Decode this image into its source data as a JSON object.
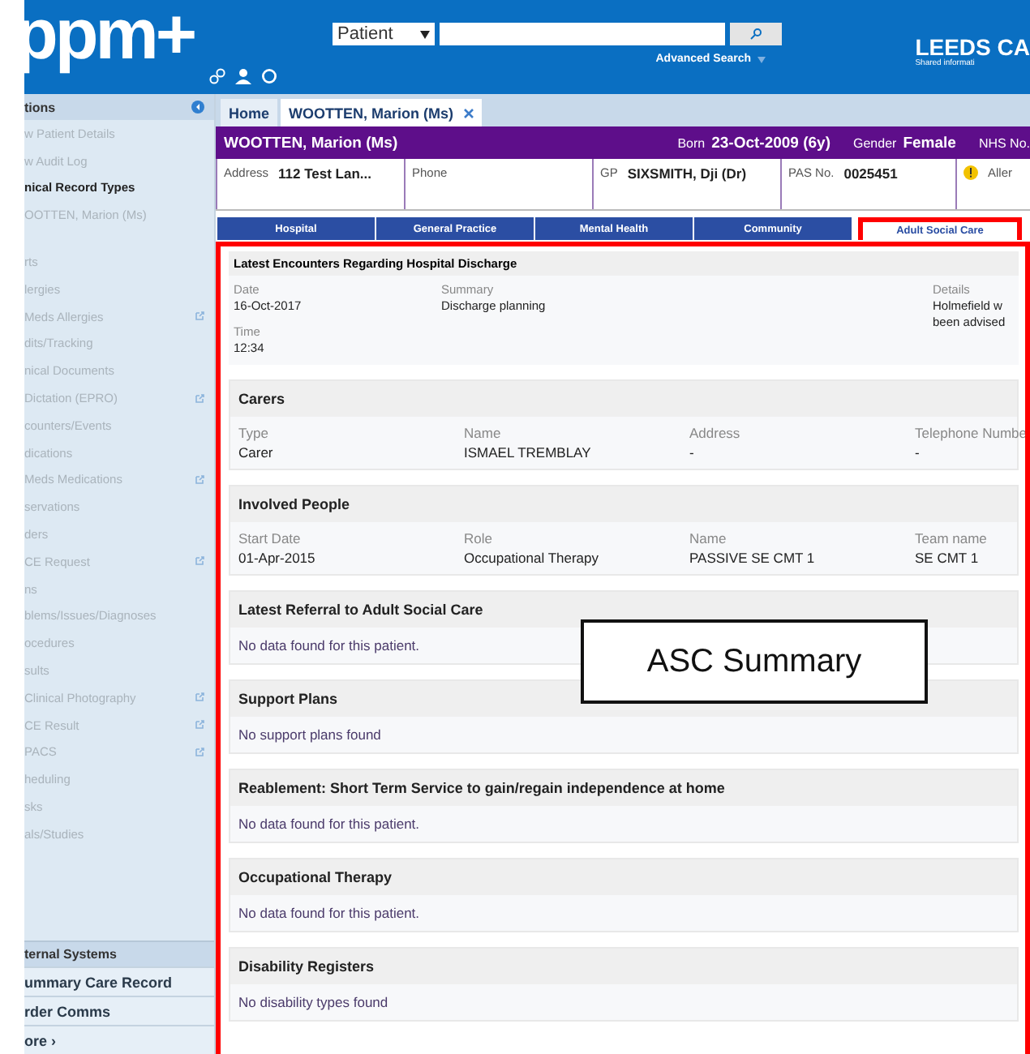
{
  "header": {
    "logo": "ppm+",
    "search_type": "Patient",
    "advanced_search": "Advanced Search",
    "brand": "LEEDS CA",
    "brand_sub": "Shared informati"
  },
  "sidebar": {
    "title": "tions",
    "items": [
      {
        "label": "w Patient Details",
        "kind": "link",
        "external": false
      },
      {
        "label": "w Audit Log",
        "kind": "link",
        "external": false
      },
      {
        "label": "nical Record Types",
        "kind": "heading",
        "external": false
      },
      {
        "label": "OOTTEN, Marion (Ms)",
        "kind": "link",
        "external": false
      },
      {
        "label": "rts",
        "kind": "gap",
        "external": false
      },
      {
        "label": "lergies",
        "kind": "link",
        "external": false
      },
      {
        "label": "Meds Allergies",
        "kind": "link",
        "external": true
      },
      {
        "label": "dits/Tracking",
        "kind": "link",
        "external": false
      },
      {
        "label": "nical Documents",
        "kind": "link",
        "external": false
      },
      {
        "label": "Dictation (EPRO)",
        "kind": "link",
        "external": true
      },
      {
        "label": "counters/Events",
        "kind": "link",
        "external": false
      },
      {
        "label": "dications",
        "kind": "link",
        "external": false
      },
      {
        "label": "Meds Medications",
        "kind": "link",
        "external": true
      },
      {
        "label": "servations",
        "kind": "link",
        "external": false
      },
      {
        "label": "ders",
        "kind": "link",
        "external": false
      },
      {
        "label": "CE Request",
        "kind": "link",
        "external": true
      },
      {
        "label": "ns",
        "kind": "link",
        "external": false
      },
      {
        "label": "blems/Issues/Diagnoses",
        "kind": "link",
        "external": false
      },
      {
        "label": "ocedures",
        "kind": "link",
        "external": false
      },
      {
        "label": "sults",
        "kind": "link",
        "external": false
      },
      {
        "label": "Clinical Photography",
        "kind": "link",
        "external": true
      },
      {
        "label": "CE Result",
        "kind": "link",
        "external": true
      },
      {
        "label": "PACS",
        "kind": "link",
        "external": true
      },
      {
        "label": "heduling",
        "kind": "link",
        "external": false
      },
      {
        "label": "sks",
        "kind": "link",
        "external": false
      },
      {
        "label": "als/Studies",
        "kind": "link",
        "external": false
      }
    ],
    "external_title": "ternal Systems",
    "external_items": [
      "ummary Care Record",
      "rder Comms",
      "ore ›"
    ]
  },
  "tabs": [
    {
      "label": "Home",
      "selected": false,
      "closable": false
    },
    {
      "label": "WOOTTEN, Marion (Ms)",
      "selected": true,
      "closable": true
    }
  ],
  "patient": {
    "name": "WOOTTEN, Marion (Ms)",
    "born_label": "Born",
    "born": "23-Oct-2009 (6y)",
    "gender_label": "Gender",
    "gender": "Female",
    "nhs_label": "NHS No.",
    "fields": [
      {
        "label": "Address",
        "value": "112 Test Lan...",
        "kind": "text"
      },
      {
        "label": "Phone",
        "kind": "text"
      },
      {
        "label": "GP",
        "value": "SIXSMITH, Dji (Dr)",
        "kind": "text"
      },
      {
        "label": "PAS No.",
        "value": "0025451",
        "kind": "text"
      },
      {
        "label": "Aller",
        "kind": "alert"
      }
    ]
  },
  "record_tabs": [
    {
      "label": "Hospital",
      "selected": false
    },
    {
      "label": "General Practice",
      "selected": false
    },
    {
      "label": "Mental Health",
      "selected": false
    },
    {
      "label": "Community",
      "selected": false
    },
    {
      "label": "Adult Social Care",
      "selected": true
    }
  ],
  "encounters": {
    "title": "Latest Encounters Regarding Hospital Discharge",
    "date_label": "Date",
    "date": "16-Oct-2017",
    "time_label": "Time",
    "time": "12:34",
    "summary_label": "Summary",
    "summary": "Discharge planning",
    "details_label": "Details",
    "details": [
      "Holmefield w",
      "been advised"
    ]
  },
  "sections": [
    {
      "title": "Carers",
      "kind": "table",
      "columns": [
        "Type",
        "Name",
        "Address",
        "Telephone Numbe"
      ],
      "row": [
        "Carer",
        "ISMAEL TREMBLAY",
        "-",
        "-"
      ]
    },
    {
      "title": "Involved People",
      "kind": "table",
      "columns": [
        "Start Date",
        "Role",
        "Name",
        "Team name"
      ],
      "row": [
        "01-Apr-2015",
        "Occupational Therapy",
        "PASSIVE SE CMT 1",
        "SE CMT 1"
      ]
    },
    {
      "title": "Latest Referral to Adult Social Care",
      "kind": "message",
      "message": "No data found for this patient."
    },
    {
      "title": "Support Plans",
      "kind": "message",
      "message": "No support plans found"
    },
    {
      "title": "Reablement: Short Term Service to gain/regain independence at home",
      "kind": "message",
      "message": "No data found for this patient."
    },
    {
      "title": "Occupational Therapy",
      "kind": "message",
      "message": "No data found for this patient."
    },
    {
      "title": "Disability Registers",
      "kind": "message",
      "message": "No disability types found"
    }
  ],
  "callout": "ASC Summary"
}
